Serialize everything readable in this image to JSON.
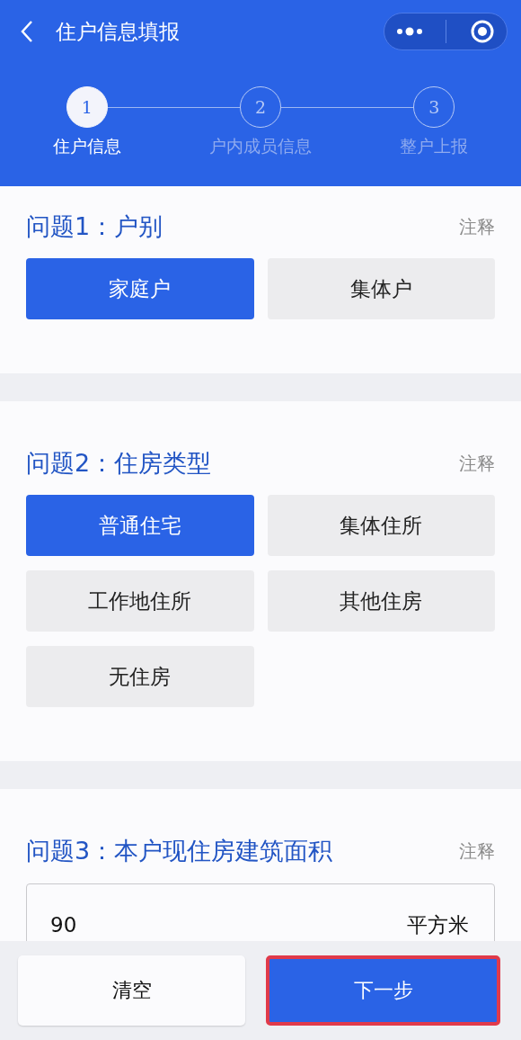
{
  "header": {
    "title": "住户信息填报"
  },
  "steps": [
    {
      "number": "1",
      "label": "住户信息",
      "selected": true
    },
    {
      "number": "2",
      "label": "户内成员信息",
      "selected": false
    },
    {
      "number": "3",
      "label": "整户上报",
      "selected": false
    }
  ],
  "questions": [
    {
      "kind": "choice",
      "title": "问题1：户别",
      "note": "注释",
      "options": [
        {
          "label": "家庭户",
          "selected": true
        },
        {
          "label": "集体户",
          "selected": false
        }
      ]
    },
    {
      "kind": "choice",
      "title": "问题2：住房类型",
      "note": "注释",
      "options": [
        {
          "label": "普通住宅",
          "selected": true
        },
        {
          "label": "集体住所",
          "selected": false
        },
        {
          "label": "工作地住所",
          "selected": false
        },
        {
          "label": "其他住房",
          "selected": false
        },
        {
          "label": "无住房",
          "selected": false
        }
      ]
    },
    {
      "kind": "input",
      "title": "问题3：本户现住房建筑面积",
      "note": "注释",
      "value": "90",
      "unit": "平方米"
    }
  ],
  "footer": {
    "buttons": [
      {
        "label": "清空",
        "kind": "secondary",
        "highlighted": false
      },
      {
        "label": "下一步",
        "kind": "primary",
        "highlighted": true
      }
    ]
  }
}
